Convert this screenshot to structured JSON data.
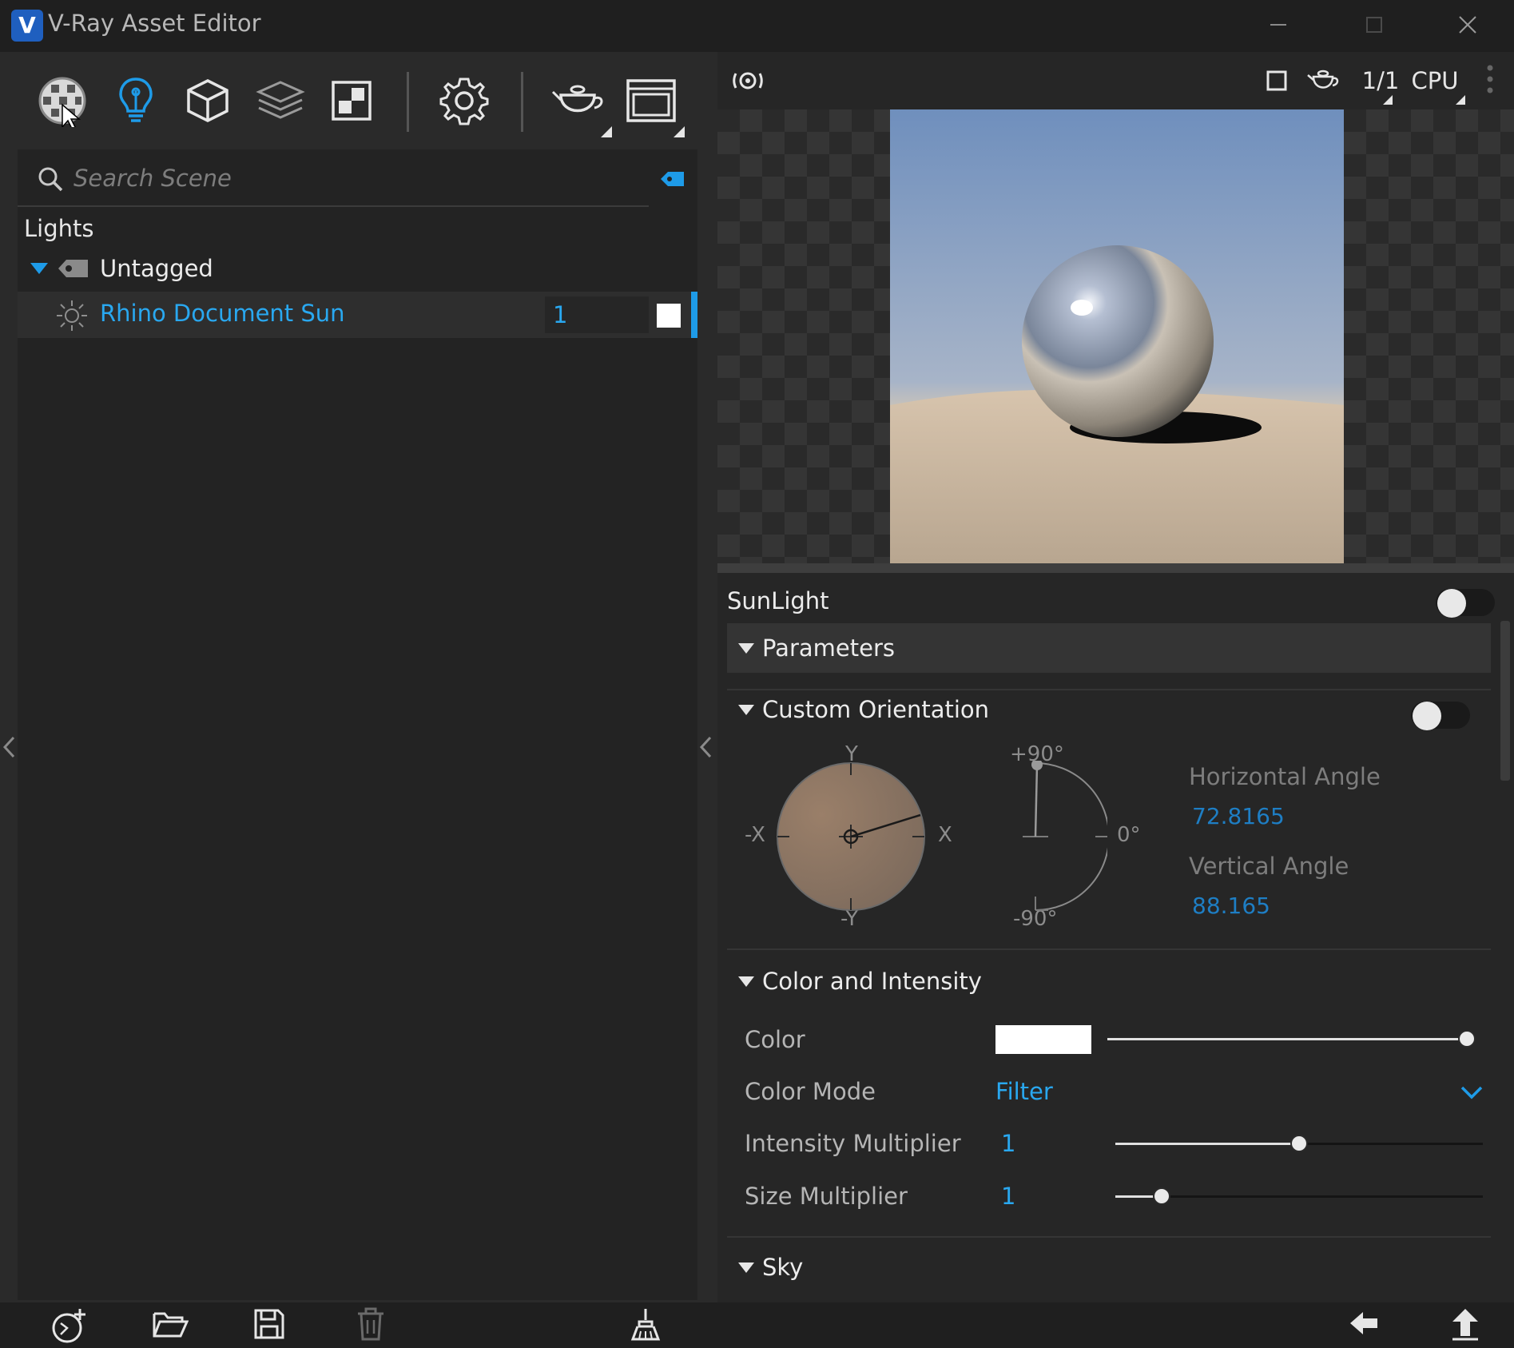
{
  "window": {
    "title": "V-Ray Asset Editor",
    "logo_letter": "V"
  },
  "toolbar": {
    "icons": [
      "materials-icon",
      "lights-icon",
      "geometry-icon",
      "textures-icon",
      "render-elements-icon",
      "settings-icon",
      "render-icon",
      "frame-buffer-icon"
    ]
  },
  "search": {
    "placeholder": "Search Scene",
    "value": ""
  },
  "scene": {
    "section": "Lights",
    "group": "Untagged",
    "asset": {
      "name": "Rhino Document Sun",
      "count": "1",
      "swatch_color": "#ffffff"
    }
  },
  "preview": {
    "ratio": "1/1",
    "engine": "CPU"
  },
  "properties": {
    "title": "SunLight",
    "enabled": false,
    "rollouts": {
      "parameters": "Parameters",
      "custom_orientation": "Custom Orientation",
      "color_intensity": "Color and Intensity",
      "sky": "Sky"
    },
    "custom_orientation_enabled": false,
    "orientation": {
      "axis_y": "Y",
      "axis_neg_y": "-Y",
      "axis_x": "X",
      "axis_neg_x": "-X",
      "v_top": "+90°",
      "v_mid": "0°",
      "v_bottom": "-90°",
      "horizontal_label": "Horizontal Angle",
      "horizontal_value": "72.8165",
      "vertical_label": "Vertical Angle",
      "vertical_value": "88.165"
    },
    "color": {
      "label": "Color",
      "swatch": "#ffffff",
      "slider_fraction": 1.0
    },
    "color_mode": {
      "label": "Color Mode",
      "value": "Filter"
    },
    "intensity": {
      "label": "Intensity Multiplier",
      "value": "1",
      "slider_fraction": 0.5
    },
    "size": {
      "label": "Size Multiplier",
      "value": "1",
      "slider_fraction": 0.125
    }
  },
  "accent_color": "#1e9be8"
}
